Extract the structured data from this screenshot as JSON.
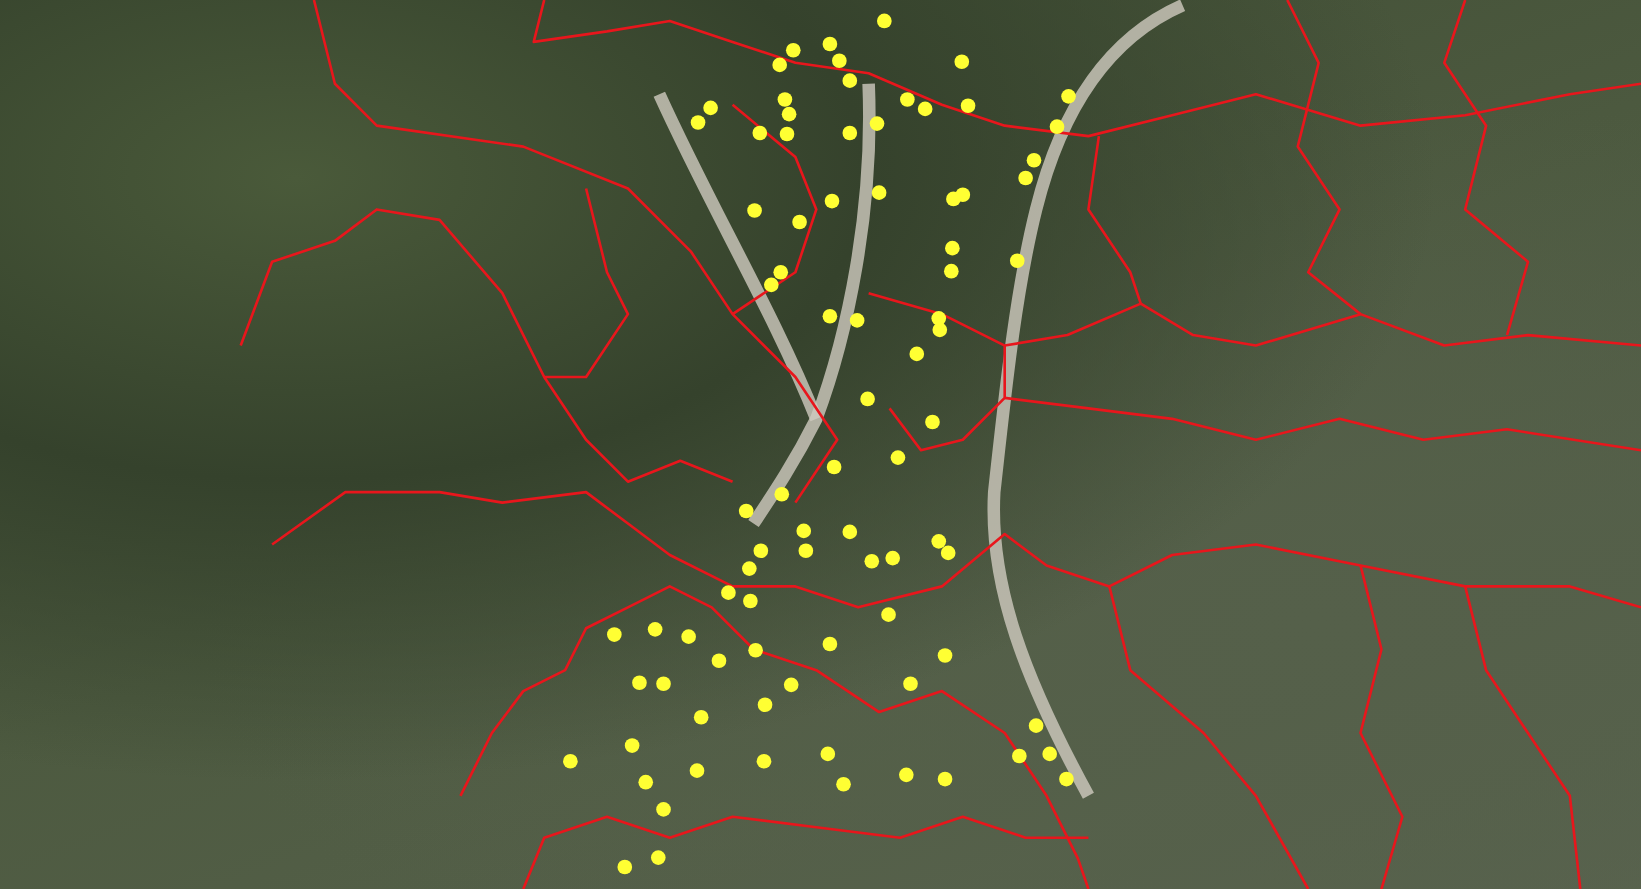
{
  "map": {
    "kind": "satellite",
    "show_boundaries": true,
    "show_markers": true
  }
}
